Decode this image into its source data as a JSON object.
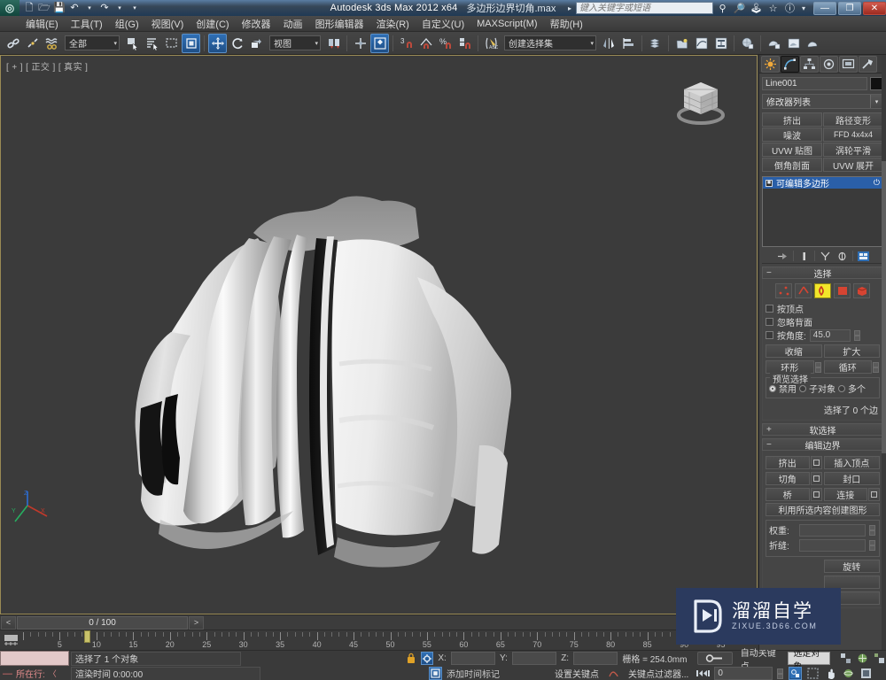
{
  "titlebar": {
    "app_title": "Autodesk 3ds Max  2012 x64",
    "file_title": "多边形边界切角.max",
    "quick_access": [
      "new-icon",
      "open-icon",
      "save-icon",
      "undo-icon",
      "redo-icon",
      "customize-qat-icon"
    ],
    "search_placeholder": "键入关键字或短语",
    "help_icons": [
      "search-references-icon",
      "search-key-icon",
      "exchange-icon",
      "favorites-icon",
      "help-icon"
    ],
    "window_buttons": {
      "minimize": "—",
      "maximize": "❐",
      "close": "✕"
    }
  },
  "menu": {
    "items": [
      {
        "label": "编辑(E)"
      },
      {
        "label": "工具(T)"
      },
      {
        "label": "组(G)"
      },
      {
        "label": "视图(V)"
      },
      {
        "label": "创建(C)"
      },
      {
        "label": "修改器"
      },
      {
        "label": "动画"
      },
      {
        "label": "图形编辑器"
      },
      {
        "label": "渲染(R)"
      },
      {
        "label": "自定义(U)"
      },
      {
        "label": "MAXScript(M)"
      },
      {
        "label": "帮助(H)"
      }
    ]
  },
  "toolbar": {
    "selection_filter": "全部",
    "reference_coord": "视图",
    "named_selection_sets": "创建选择集",
    "buttons": [
      "select-link-icon",
      "unlink-icon",
      "bind-space-warp-icon",
      "select-object-icon",
      "select-by-name-icon",
      "rect-selection-region-icon",
      "window-crossing-icon",
      "select-move-icon",
      "select-rotate-icon",
      "select-scale-icon",
      "use-pivot-center-icon",
      "align-center-icon",
      "snap-toggle-icon",
      "angle-snap-icon",
      "percent-snap-icon",
      "spinner-snap-icon",
      "edit-named-selection-icon",
      "mirror-icon",
      "align-icon",
      "layer-manager-icon",
      "graphite-tools-icon",
      "curve-editor-icon",
      "schematic-view-icon",
      "material-editor-icon",
      "render-setup-icon",
      "rendered-frame-icon",
      "render-production-icon"
    ]
  },
  "viewport": {
    "label": "[ + ] [ 正交 ] [ 真实 ]",
    "viewcube_name": "view-cube",
    "axis_tripod": {
      "x": "X",
      "y": "Y",
      "z": "Z"
    },
    "model_name": "shirt-mesh-object"
  },
  "time_slider": {
    "prev_label": "<",
    "next_label": ">",
    "current": "0 / 100"
  },
  "track_bar": {
    "ticks_labels": [
      "5",
      "10",
      "15",
      "20",
      "25",
      "30",
      "35",
      "40",
      "45",
      "50",
      "55",
      "60",
      "65",
      "70",
      "75",
      "80",
      "85",
      "90",
      "95"
    ],
    "open_mini_curve_editor_icon": "mini-curve-editor-icon"
  },
  "status": {
    "maxscript_prompt_label": "所在行:",
    "maxscript_prompt_dash": "—",
    "maxscript_prompt_arrow": "〈",
    "prompt_line": "选择了 1 个对象",
    "render_time": "渲染时间 0:00:00",
    "lock_icon": "lock-selection-icon",
    "coord_icon": "absolute-relative-icon",
    "x_label": "X:",
    "y_label": "Y:",
    "z_label": "Z:",
    "x_value": "",
    "y_value": "",
    "z_value": "",
    "grid_label": "栅格 = 254.0mm",
    "add_time_tag": "添加时间标记",
    "add_time_tag_icon": "time-tag-icon",
    "auto_key": "自动关键点",
    "set_key": "设置关键点",
    "selected_object": "选定对象",
    "key_filters": "关键点过滤器...",
    "key_mode_icon": "key-mode-toggle-icon",
    "frame_value": "0",
    "nav_icons": [
      "zoom-icon",
      "zoom-all-icon",
      "zoom-extents-icon",
      "zoom-region-icon",
      "pan-icon",
      "orbit-icon",
      "maximize-viewport-icon"
    ]
  },
  "command_panel": {
    "tabs": [
      {
        "name": "create-tab",
        "icon": "create-star-icon",
        "active": false
      },
      {
        "name": "modify-tab",
        "icon": "modify-curve-icon",
        "active": true
      },
      {
        "name": "hierarchy-tab",
        "icon": "hierarchy-icon",
        "active": false
      },
      {
        "name": "motion-tab",
        "icon": "motion-wheel-icon",
        "active": false
      },
      {
        "name": "display-tab",
        "icon": "display-monitor-icon",
        "active": false
      },
      {
        "name": "utilities-tab",
        "icon": "utilities-hammer-icon",
        "active": false
      }
    ],
    "object_name": "Line001",
    "modifier_list_label": "修改器列表",
    "modifier_buttons": [
      "挤出",
      "路径变形",
      "噪波",
      "FFD 4x4x4",
      "UVW 贴图",
      "涡轮平滑",
      "倒角剖面",
      "UVW 展开"
    ],
    "stack": [
      {
        "label": "可编辑多边形",
        "selected": true
      }
    ],
    "stack_tools": [
      "pin-stack-icon",
      "show-end-result-icon",
      "make-unique-icon",
      "remove-modifier-icon",
      "configure-modifier-sets-icon"
    ],
    "selection_rollout": {
      "title": "选择",
      "subobject_buttons": [
        {
          "name": "vertex-subobject",
          "active": false
        },
        {
          "name": "edge-subobject",
          "active": false
        },
        {
          "name": "border-subobject",
          "active": true
        },
        {
          "name": "polygon-subobject",
          "active": false
        },
        {
          "name": "element-subobject",
          "active": false
        }
      ],
      "by_vertex": "按顶点",
      "ignore_backfacing": "忽略背面",
      "by_angle": "按角度:",
      "by_angle_value": "45.0",
      "shrink": "收缩",
      "grow": "扩大",
      "ring": "环形",
      "loop": "循环",
      "preview_selection_title": "预览选择",
      "preview_options": [
        {
          "label": "禁用",
          "selected": true
        },
        {
          "label": "子对象",
          "selected": false
        },
        {
          "label": "多个",
          "selected": false
        }
      ],
      "selection_count": "选择了 0 个边"
    },
    "soft_selection_rollout": {
      "title": "软选择",
      "collapsed": true
    },
    "edit_border_rollout": {
      "title": "编辑边界",
      "extrude": "挤出",
      "insert_vertex": "插入顶点",
      "chamfer": "切角",
      "cap": "封口",
      "bridge": "桥",
      "connect": "连接",
      "create_shape_from_selection": "利用所选内容创建图形",
      "weight_label": "权重:",
      "weight_value": "",
      "crease_label": "折缝:",
      "crease_value": "",
      "rotate": "旋转"
    }
  },
  "watermark": {
    "main": "溜溜自学",
    "sub": "ZIXUE.3D66.COM",
    "icon": "play-logo-icon",
    "bg": "#2b3a5e"
  },
  "colors": {
    "panel_bg": "#444444",
    "viewport_bg": "#3b3b3b",
    "accent_blue": "#2a5fa8",
    "active_yellow": "#f2e52a",
    "title_blue": "#35527 0"
  }
}
